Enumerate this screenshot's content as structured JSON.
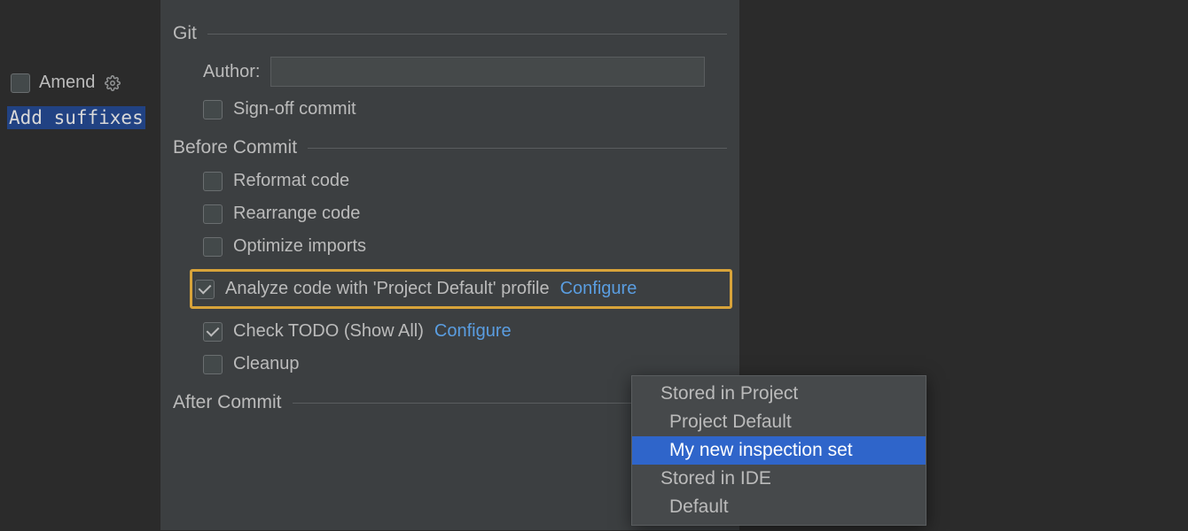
{
  "left": {
    "amend_label": "Amend",
    "commit_message": "Add suffixes"
  },
  "panel": {
    "git": {
      "title": "Git",
      "author_label": "Author:",
      "author_value": "",
      "signoff_label": "Sign-off commit",
      "signoff_checked": false
    },
    "before_commit": {
      "title": "Before Commit",
      "items": [
        {
          "label": "Reformat code",
          "checked": false
        },
        {
          "label": "Rearrange code",
          "checked": false
        },
        {
          "label": "Optimize imports",
          "checked": false
        },
        {
          "label": "Analyze code with 'Project Default' profile",
          "checked": true,
          "configure": "Configure",
          "highlighted": true
        },
        {
          "label": "Check TODO (Show All)",
          "checked": true,
          "configure": "Configure"
        },
        {
          "label": "Cleanup",
          "checked": false
        }
      ]
    },
    "after_commit": {
      "title": "After Commit"
    }
  },
  "dropdown": {
    "groups": [
      {
        "label": "Stored in Project",
        "items": [
          {
            "label": "Project Default",
            "selected": false
          },
          {
            "label": "My new inspection set",
            "selected": true
          }
        ]
      },
      {
        "label": "Stored in IDE",
        "items": [
          {
            "label": "Default",
            "selected": false
          }
        ]
      }
    ]
  }
}
